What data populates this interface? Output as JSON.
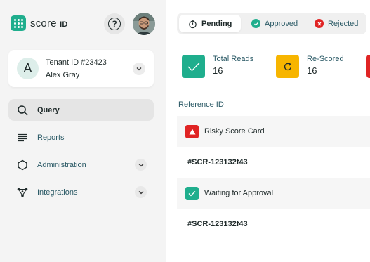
{
  "logo": {
    "brand": "score",
    "suffix": "ID"
  },
  "tenant": {
    "initial": "A",
    "id_label": "Tenant ID #23423",
    "user_name": "Alex Gray"
  },
  "nav": {
    "items": [
      {
        "label": "Query",
        "icon": "search-icon",
        "active": true
      },
      {
        "label": "Reports",
        "icon": "list-icon"
      },
      {
        "label": "Administration",
        "icon": "hexagon-icon",
        "has_children": true
      },
      {
        "label": "Integrations",
        "icon": "network-icon",
        "has_children": true
      }
    ]
  },
  "tabs": [
    {
      "label": "Pending",
      "icon": "timer-icon",
      "active": true
    },
    {
      "label": "Approved",
      "icon": "check-circle-icon"
    },
    {
      "label": "Rejected",
      "icon": "x-circle-icon"
    }
  ],
  "stats": [
    {
      "label": "Total Reads",
      "value": "16",
      "color": "#1fae8d",
      "icon": "check-icon"
    },
    {
      "label": "Re-Scored",
      "value": "16",
      "color": "#f7b500",
      "icon": "refresh-icon"
    },
    {
      "label": "",
      "value": "",
      "color": "#e02424",
      "icon": "alert-icon"
    }
  ],
  "table": {
    "column_header": "Reference ID",
    "rows": [
      {
        "text": "Risky Score Card",
        "icon": "warning-icon",
        "icon_color": "#e02424"
      },
      {
        "text": "#SCR-123132f43"
      },
      {
        "text": "Waiting for Approval",
        "icon": "check-icon",
        "icon_color": "#1fae8d"
      },
      {
        "text": "#SCR-123132f43"
      }
    ]
  },
  "colors": {
    "brand": "#1fae8d",
    "sidebar_bg": "#f4f4f4",
    "text_link": "#2b5a66",
    "warning": "#f7b500",
    "danger": "#e02424"
  }
}
